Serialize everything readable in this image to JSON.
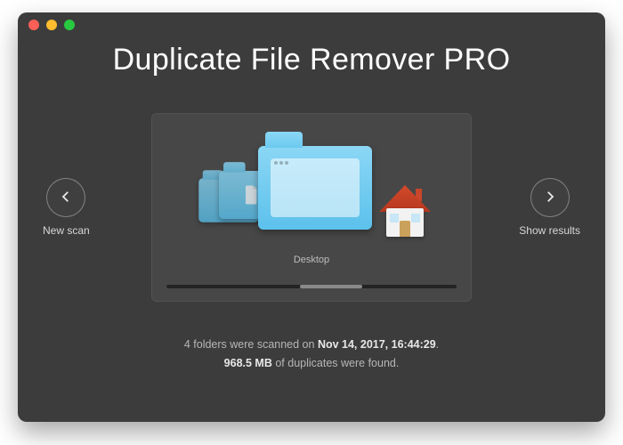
{
  "app": {
    "title": "Duplicate File Remover PRO"
  },
  "nav": {
    "left_label": "New scan",
    "right_label": "Show results"
  },
  "carousel": {
    "selected_label": "Desktop",
    "items": [
      {
        "name": "globe-folder",
        "icon": "globe-icon"
      },
      {
        "name": "documents-folder",
        "icon": "document-icon"
      },
      {
        "name": "desktop-folder",
        "icon": "window-icon"
      },
      {
        "name": "home-folder",
        "icon": "house-icon"
      }
    ]
  },
  "summary": {
    "line1_prefix": "4 folders were scanned on ",
    "timestamp": "Nov 14, 2017, 16:44:29",
    "line1_suffix": ".",
    "line2_value": "968.5 MB",
    "line2_suffix": " of duplicates were found."
  },
  "colors": {
    "window_bg": "#3c3c3c",
    "folder_blue": "#6bc9ef",
    "roof_red": "#c9462a"
  }
}
